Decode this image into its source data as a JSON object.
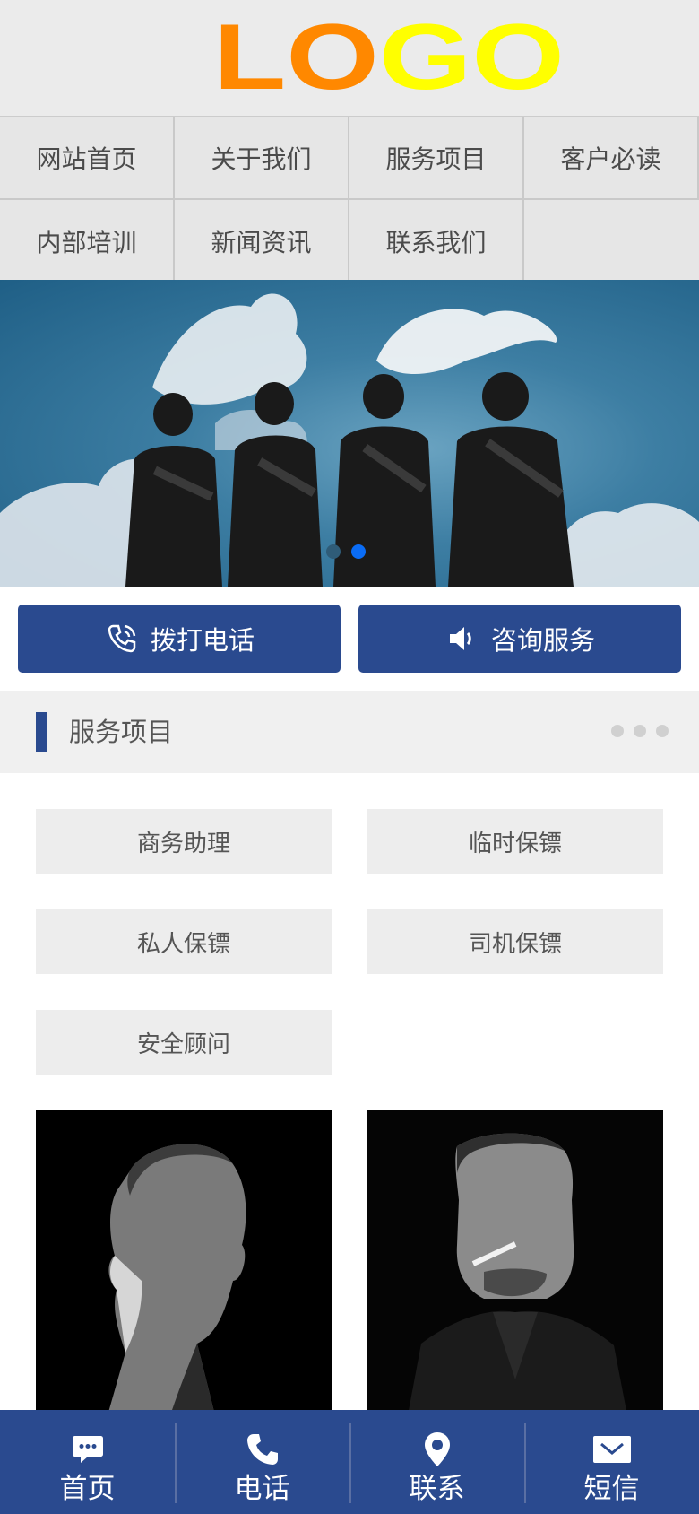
{
  "header": {
    "logo_part1": "LO",
    "logo_part2": "GO",
    "logo_color1": "#ff8800",
    "logo_color2": "#ffff00"
  },
  "nav": {
    "items": [
      {
        "label": "网站首页"
      },
      {
        "label": "关于我们"
      },
      {
        "label": "服务项目"
      },
      {
        "label": "客户必读"
      },
      {
        "label": "内部培训"
      },
      {
        "label": "新闻资讯"
      },
      {
        "label": "联系我们"
      }
    ]
  },
  "banner": {
    "image": "tactical-team-sky-photo",
    "slide_count": 2,
    "active_slide": 2
  },
  "actions": {
    "call_label": "拨打电话",
    "call_icon": "phone-icon",
    "consult_label": "咨询服务",
    "consult_icon": "speaker-icon"
  },
  "section": {
    "title": "服务项目",
    "more_icon": "more-dots-icon"
  },
  "services": {
    "items": [
      {
        "label": "商务助理"
      },
      {
        "label": "临时保镖"
      },
      {
        "label": "私人保镖"
      },
      {
        "label": "司机保镖"
      },
      {
        "label": "安全顾问"
      }
    ]
  },
  "photos": [
    {
      "image": "man-profile-portrait"
    },
    {
      "image": "man-with-cigarette-portrait"
    }
  ],
  "bottom_bar": {
    "items": [
      {
        "label": "首页",
        "icon": "chat-bubble-icon"
      },
      {
        "label": "电话",
        "icon": "phone-icon"
      },
      {
        "label": "联系",
        "icon": "location-pin-icon"
      },
      {
        "label": "短信",
        "icon": "envelope-icon"
      }
    ]
  },
  "colors": {
    "brand_blue": "#2a4a8f",
    "nav_bg": "#e6e6e6",
    "tile_bg": "#ededed",
    "active_dot": "#0a6cf5"
  }
}
